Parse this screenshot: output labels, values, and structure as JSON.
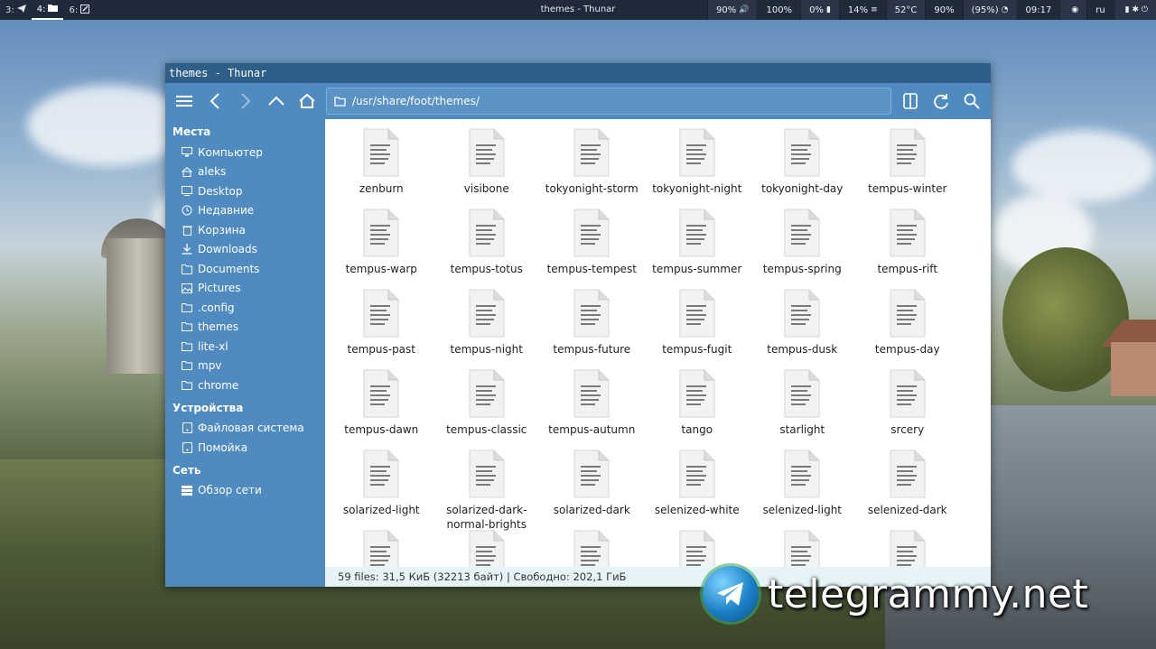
{
  "topbar": {
    "workspaces": [
      {
        "label": "3:",
        "icon": "send-icon"
      },
      {
        "label": "4:",
        "icon": "folder-icon",
        "active": true
      },
      {
        "label": "6:",
        "icon": "edit-icon"
      }
    ],
    "window_title": "themes - Thunar",
    "stats": [
      {
        "text": "90%",
        "icon": "volume-icon"
      },
      {
        "text": "100%"
      },
      {
        "text": "0%",
        "icon": "battery-icon"
      },
      {
        "text": "14%",
        "icon": "memory-icon"
      },
      {
        "text": "52°C"
      },
      {
        "text": "90%"
      },
      {
        "text": "(95%)",
        "icon": "wifi-icon"
      },
      {
        "text": "09:17"
      },
      {
        "text": "",
        "icon": "eye-icon"
      },
      {
        "text": "ru"
      },
      {
        "text": "",
        "icon": "tray-icons"
      }
    ]
  },
  "window": {
    "title": "themes - Thunar",
    "path": "/usr/share/foot/themes/"
  },
  "sidebar": {
    "sections": [
      {
        "title": "Места",
        "items": [
          {
            "label": "Компьютер",
            "icon": "computer-icon"
          },
          {
            "label": "aleks",
            "icon": "home-icon"
          },
          {
            "label": "Desktop",
            "icon": "desktop-icon"
          },
          {
            "label": "Недавние",
            "icon": "recent-icon"
          },
          {
            "label": "Корзина",
            "icon": "trash-icon"
          },
          {
            "label": "Downloads",
            "icon": "download-icon"
          },
          {
            "label": "Documents",
            "icon": "documents-icon"
          },
          {
            "label": "Pictures",
            "icon": "pictures-icon"
          },
          {
            "label": ".config",
            "icon": "folder-icon"
          },
          {
            "label": "themes",
            "icon": "folder-icon"
          },
          {
            "label": "lite-xl",
            "icon": "folder-icon"
          },
          {
            "label": "mpv",
            "icon": "folder-icon"
          },
          {
            "label": "chrome",
            "icon": "folder-icon"
          }
        ]
      },
      {
        "title": "Устройства",
        "items": [
          {
            "label": "Файловая система",
            "icon": "drive-icon"
          },
          {
            "label": "Помойка",
            "icon": "drive-icon"
          }
        ]
      },
      {
        "title": "Сеть",
        "items": [
          {
            "label": "Обзор сети",
            "icon": "network-icon"
          }
        ]
      }
    ]
  },
  "files": [
    "zenburn",
    "visibone",
    "tokyonight-storm",
    "tokyonight-night",
    "tokyonight-day",
    "tempus-winter",
    "tempus-warp",
    "tempus-totus",
    "tempus-tempest",
    "tempus-summer",
    "tempus-spring",
    "tempus-rift",
    "tempus-past",
    "tempus-night",
    "tempus-future",
    "tempus-fugit",
    "tempus-dusk",
    "tempus-day",
    "tempus-dawn",
    "tempus-classic",
    "tempus-autumn",
    "tango",
    "starlight",
    "srcery",
    "solarized-light",
    "solarized-dark-\nnormal-brights",
    "solarized-dark",
    "selenized-white",
    "selenized-light",
    "selenized-dark",
    "",
    "",
    "",
    "",
    "",
    ""
  ],
  "statusbar": "59 files: 31,5 КиБ (32213 байт)  |  Свободно: 202,1 ГиБ",
  "watermark": "telegrammy.net"
}
